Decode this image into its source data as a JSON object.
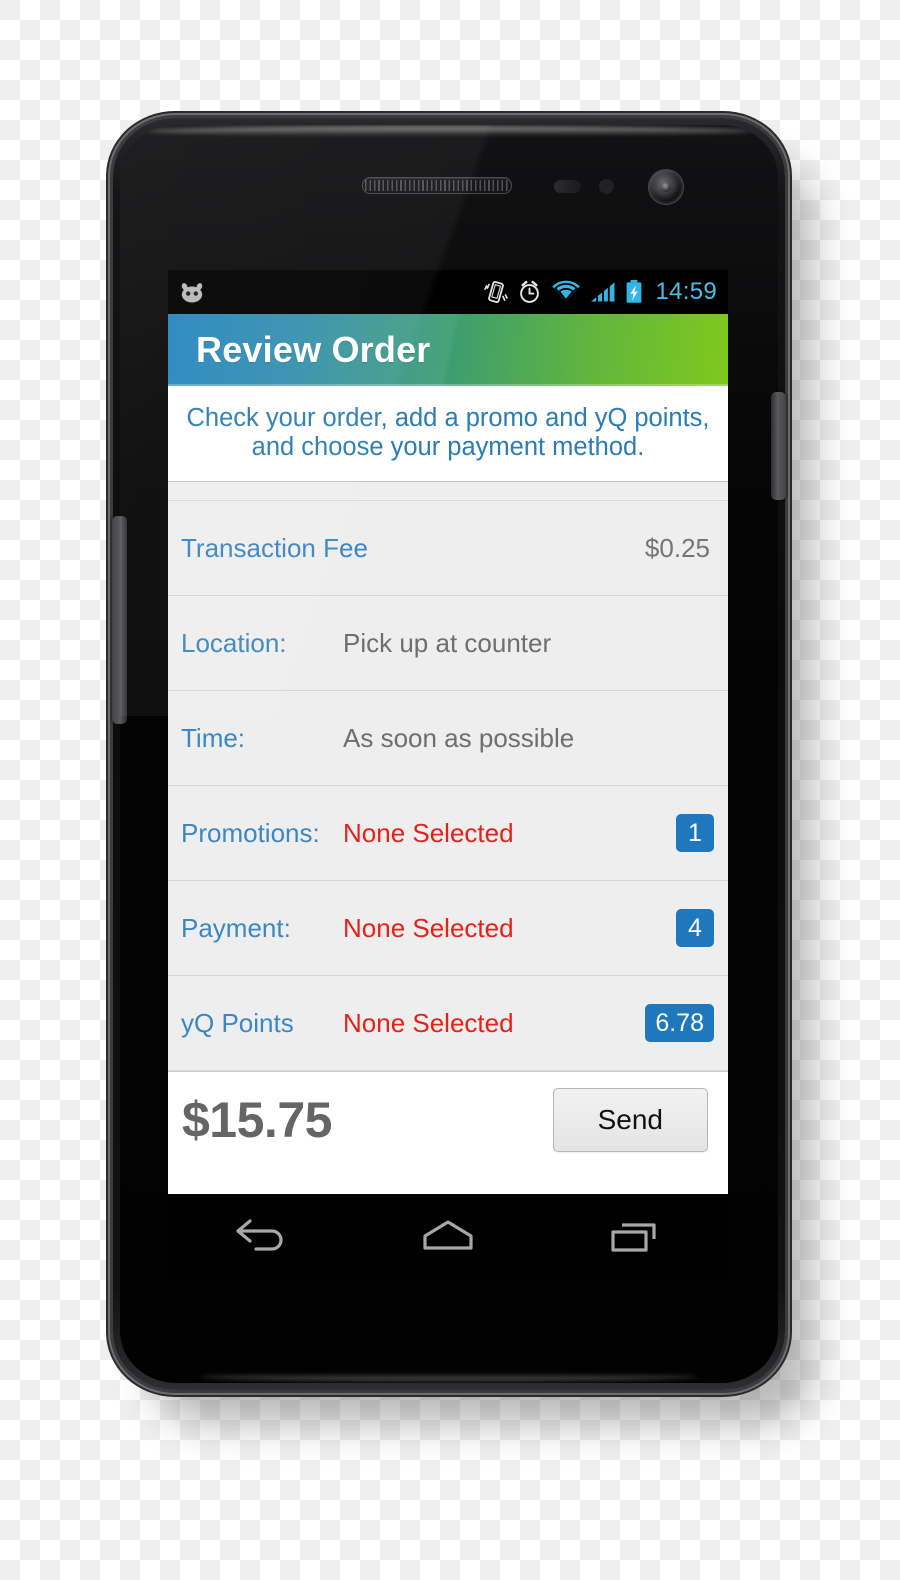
{
  "device": {
    "name": "android-smartphone",
    "parts": [
      "earpiece-speaker",
      "proximity-sensor",
      "light-sensor",
      "front-camera",
      "power-button",
      "volume-rocker"
    ]
  },
  "status_bar": {
    "logo_icon": "android-jellybean-mascot-icon",
    "icons": [
      "vibrate-icon",
      "alarm-clock-icon",
      "wifi-icon",
      "cellular-signal-icon",
      "battery-charging-icon"
    ],
    "clock": "14:59"
  },
  "header": {
    "title": "Review Order",
    "gradient_start": "#1a7fbb",
    "gradient_end": "#80c81e"
  },
  "instruction": {
    "text": "Check your order, add a promo and yQ points, and choose your payment method.",
    "color": "#2b7cb5"
  },
  "list": {
    "rows": [
      {
        "label": "Transaction Fee",
        "value": "$0.25",
        "value_kind": "amount",
        "badge": null
      },
      {
        "label": "Location:",
        "value": "Pick up at counter",
        "value_kind": "plain",
        "badge": null
      },
      {
        "label": "Time:",
        "value": "As soon as possible",
        "value_kind": "plain",
        "badge": null
      },
      {
        "label": "Promotions:",
        "value": "None Selected",
        "value_kind": "none-selected",
        "badge": "1"
      },
      {
        "label": "Payment:",
        "value": "None Selected",
        "value_kind": "none-selected",
        "badge": "4"
      },
      {
        "label": "yQ Points",
        "value": "None Selected",
        "value_kind": "none-selected",
        "badge": "6.78"
      }
    ],
    "label_color": "#3b86c4",
    "value_color": "#6e6e6e",
    "none_selected_color": "#e8201a",
    "badge_color": "#1f78bd"
  },
  "total_bar": {
    "amount": "$15.75",
    "send_label": "Send"
  },
  "nav_bar": {
    "buttons": [
      "back-icon",
      "home-icon",
      "recent-apps-icon"
    ]
  }
}
